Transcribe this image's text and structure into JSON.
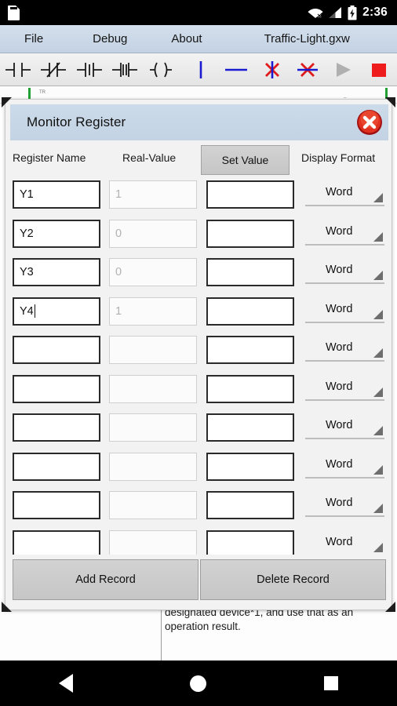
{
  "status_bar": {
    "storage_icon": "sd-card-icon",
    "wifi_icon": "wifi-disconnected-icon",
    "signal_icon": "cellular-signal-icon",
    "battery_icon": "battery-charging-icon",
    "time": "2:36"
  },
  "menu_bar": {
    "items": [
      {
        "label": "File",
        "name": "menu-file"
      },
      {
        "label": "Debug",
        "name": "menu-debug"
      },
      {
        "label": "About",
        "name": "menu-about"
      }
    ],
    "document_title": "Traffic-Light.gxw"
  },
  "toolbar": {
    "buttons": [
      {
        "name": "contact-no-icon",
        "title": "Normally Open Contact"
      },
      {
        "name": "contact-nc-icon",
        "title": "Normally Closed Contact"
      },
      {
        "name": "contact-rising-icon",
        "title": "Rising Edge Contact"
      },
      {
        "name": "contact-falling-icon",
        "title": "Falling Edge Contact"
      },
      {
        "name": "coil-output-icon",
        "title": "Output Coil"
      },
      {
        "name": "vertical-line-icon",
        "title": "Vertical Line"
      },
      {
        "name": "horizontal-line-icon",
        "title": "Horizontal Line"
      },
      {
        "name": "delete-vertical-icon",
        "title": "Delete Vertical Line"
      },
      {
        "name": "delete-horizontal-icon",
        "title": "Delete Horizontal Line"
      },
      {
        "name": "run-icon",
        "title": "Run"
      },
      {
        "name": "stop-icon",
        "title": "Stop"
      }
    ],
    "colors": {
      "blue": "#1a1ad0",
      "red": "#e01b1b",
      "run_disabled": "#b0b0b0",
      "stop": "#ee1c1c"
    }
  },
  "ladder_strip": {
    "rung_label": "TR",
    "rail_color": "#22a033"
  },
  "dialog": {
    "title": "Monitor Register",
    "close_icon": "close-icon",
    "header_color": "#c8d8e8",
    "columns": {
      "register_name": "Register Name",
      "real_value": "Real-Value",
      "set_value": "Set Value",
      "display_format": "Display Format"
    },
    "rows": [
      {
        "register_name": "Y1",
        "real_value": "1",
        "set_value": "",
        "display_format": "Word",
        "editing": false
      },
      {
        "register_name": "Y2",
        "real_value": "0",
        "set_value": "",
        "display_format": "Word",
        "editing": false
      },
      {
        "register_name": "Y3",
        "real_value": "0",
        "set_value": "",
        "display_format": "Word",
        "editing": false
      },
      {
        "register_name": "Y4",
        "real_value": "1",
        "set_value": "",
        "display_format": "Word",
        "editing": true
      },
      {
        "register_name": "",
        "real_value": "",
        "set_value": "",
        "display_format": "Word",
        "editing": false
      },
      {
        "register_name": "",
        "real_value": "",
        "set_value": "",
        "display_format": "Word",
        "editing": false
      },
      {
        "register_name": "",
        "real_value": "",
        "set_value": "",
        "display_format": "Word",
        "editing": false
      },
      {
        "register_name": "",
        "real_value": "",
        "set_value": "",
        "display_format": "Word",
        "editing": false
      },
      {
        "register_name": "",
        "real_value": "",
        "set_value": "",
        "display_format": "Word",
        "editing": false
      },
      {
        "register_name": "",
        "real_value": "",
        "set_value": "",
        "display_format": "Word",
        "editing": false
      }
    ],
    "footer": {
      "add_record": "Add Record",
      "delete_record": "Delete Record"
    }
  },
  "background_document": {
    "text": "designated device*1, and use that as an operation result."
  },
  "nav_bar": {
    "back": "back-icon",
    "home": "home-icon",
    "recents": "recents-icon"
  }
}
